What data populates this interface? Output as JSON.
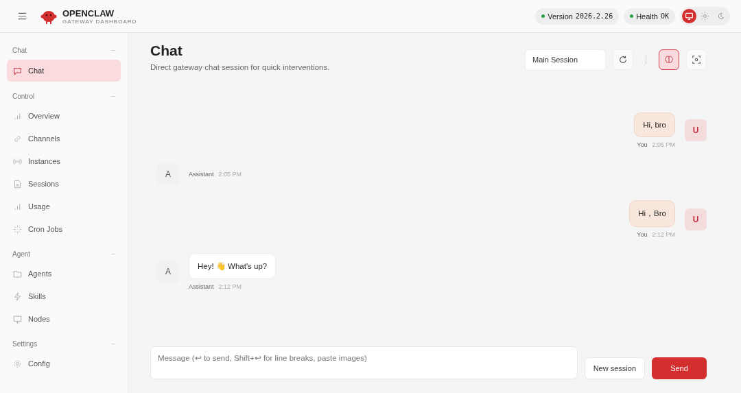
{
  "header": {
    "brand": "OPENCLAW",
    "subtitle": "GATEWAY DASHBOARD",
    "pills": [
      {
        "label": "Version",
        "value": "2026.2.26",
        "color": "#22a447"
      },
      {
        "label": "Health",
        "value": "OK",
        "color": "#22a447"
      }
    ],
    "theme_options": [
      {
        "selected": true
      },
      {
        "selected": false
      },
      {
        "selected": false
      }
    ]
  },
  "sidebar": {
    "sections": [
      {
        "title": "Chat",
        "toggle": "−",
        "items": [
          {
            "label": "Chat",
            "selected": true
          }
        ]
      },
      {
        "title": "Control",
        "toggle": "−",
        "items": [
          {
            "label": "Overview",
            "selected": false
          },
          {
            "label": "Channels",
            "selected": false
          },
          {
            "label": "Instances",
            "selected": false
          },
          {
            "label": "Sessions",
            "selected": false
          },
          {
            "label": "Usage",
            "selected": false
          },
          {
            "label": "Cron Jobs",
            "selected": false
          }
        ]
      },
      {
        "title": "Agent",
        "toggle": "−",
        "items": [
          {
            "label": "Agents",
            "selected": false
          },
          {
            "label": "Skills",
            "selected": false
          },
          {
            "label": "Nodes",
            "selected": false
          }
        ]
      },
      {
        "title": "Settings",
        "toggle": "−",
        "items": [
          {
            "label": "Config",
            "selected": false
          }
        ]
      }
    ]
  },
  "page": {
    "title": "Chat",
    "subtitle": "Direct gateway chat session for quick interventions.",
    "session": "Main Session",
    "thinking_on": true
  },
  "messages": [
    {
      "kind": "user",
      "avatar": "U",
      "text": "Hi, bro",
      "sender": "You",
      "time": "2:05 PM"
    },
    {
      "kind": "assistant",
      "avatar": "A",
      "sender": "Assistant",
      "time": "2:05 PM"
    },
    {
      "kind": "user",
      "avatar": "U",
      "text": "Hi，Bro",
      "sender": "You",
      "time": "2:12 PM"
    },
    {
      "kind": "assistant",
      "avatar": "A",
      "text": "Hey! 👋 What's up?",
      "sender": "Assistant",
      "time": "2:12 PM"
    }
  ],
  "composer": {
    "placeholder": "Message (↩ to send, Shift+↩ for line breaks, paste images)",
    "buttons": [
      {
        "label": "New session",
        "kind": "secondary"
      },
      {
        "label": "Send",
        "kind": "primary"
      }
    ]
  }
}
